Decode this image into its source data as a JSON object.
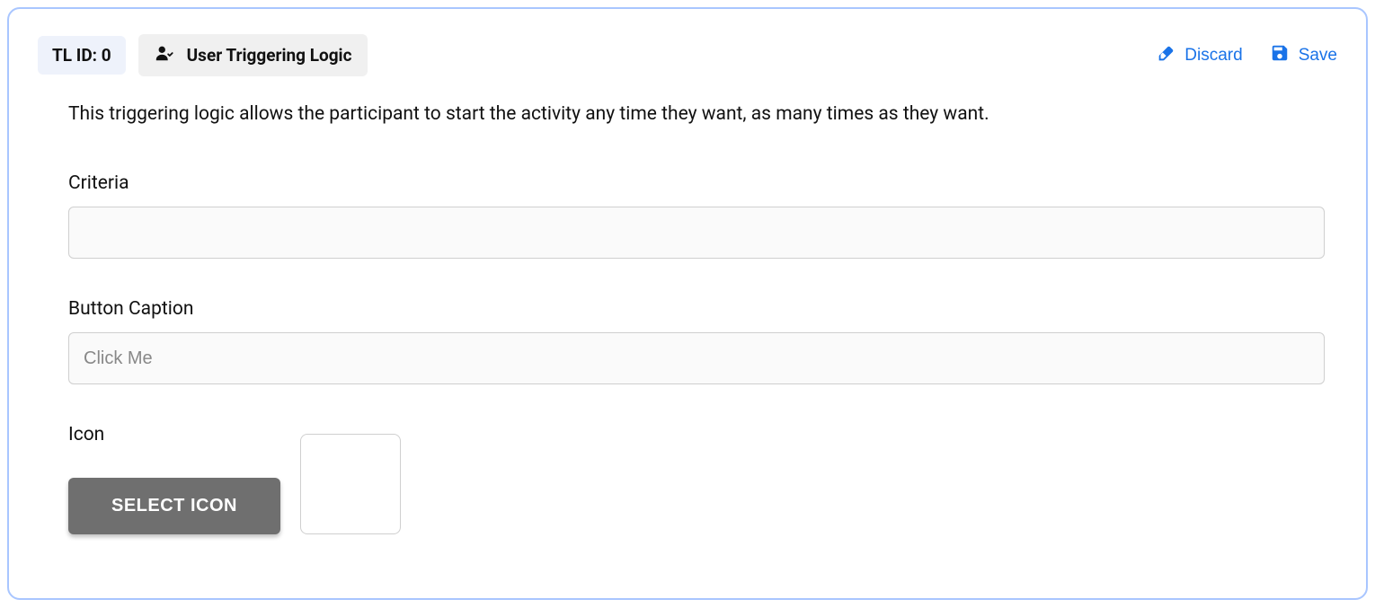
{
  "header": {
    "tl_id_label": "TL ID: 0",
    "logic_type_label": "User Triggering Logic",
    "discard_label": "Discard",
    "save_label": "Save"
  },
  "description": "This triggering logic allows the participant to start the activity any time they want, as many times as they want.",
  "form": {
    "criteria": {
      "label": "Criteria",
      "value": ""
    },
    "button_caption": {
      "label": "Button Caption",
      "placeholder": "Click Me",
      "value": ""
    },
    "icon": {
      "label": "Icon",
      "select_button_label": "SELECT ICON"
    }
  }
}
